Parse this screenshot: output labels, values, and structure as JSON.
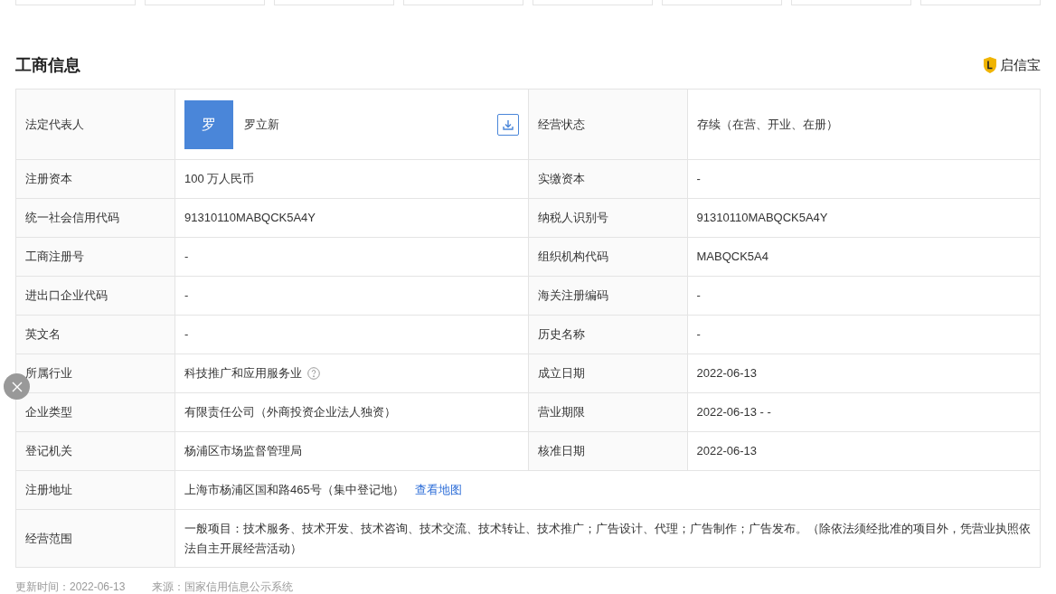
{
  "section": {
    "title": "工商信息",
    "brand": "启信宝"
  },
  "rows": [
    {
      "cells": [
        {
          "label": "法定代表人",
          "kind": "person",
          "avatar": "罗",
          "value": "罗立新"
        },
        {
          "label": "经营状态",
          "kind": "text",
          "value": "存续（在营、开业、在册）"
        }
      ]
    },
    {
      "cells": [
        {
          "label": "注册资本",
          "kind": "text",
          "value": "100 万人民币"
        },
        {
          "label": "实缴资本",
          "kind": "text",
          "value": "-"
        }
      ]
    },
    {
      "cells": [
        {
          "label": "统一社会信用代码",
          "kind": "text",
          "value": "91310110MABQCK5A4Y"
        },
        {
          "label": "纳税人识别号",
          "kind": "text",
          "value": "91310110MABQCK5A4Y"
        }
      ]
    },
    {
      "cells": [
        {
          "label": "工商注册号",
          "kind": "text",
          "value": "-"
        },
        {
          "label": "组织机构代码",
          "kind": "text",
          "value": "MABQCK5A4"
        }
      ]
    },
    {
      "cells": [
        {
          "label": "进出口企业代码",
          "kind": "text",
          "value": "-"
        },
        {
          "label": "海关注册编码",
          "kind": "text",
          "value": "-"
        }
      ]
    },
    {
      "cells": [
        {
          "label": "英文名",
          "kind": "text",
          "value": "-"
        },
        {
          "label": "历史名称",
          "kind": "text",
          "value": "-"
        }
      ]
    },
    {
      "cells": [
        {
          "label": "所属行业",
          "kind": "help",
          "value": "科技推广和应用服务业"
        },
        {
          "label": "成立日期",
          "kind": "text",
          "value": "2022-06-13"
        }
      ]
    },
    {
      "cells": [
        {
          "label": "企业类型",
          "kind": "text",
          "value": "有限责任公司（外商投资企业法人独资）"
        },
        {
          "label": "营业期限",
          "kind": "text",
          "value": "2022-06-13 - -"
        }
      ]
    },
    {
      "cells": [
        {
          "label": "登记机关",
          "kind": "text",
          "value": "杨浦区市场监督管理局"
        },
        {
          "label": "核准日期",
          "kind": "text",
          "value": "2022-06-13"
        }
      ]
    },
    {
      "cells": [
        {
          "label": "注册地址",
          "kind": "link",
          "value": "上海市杨浦区国和路465号（集中登记地）",
          "link": "查看地图"
        }
      ]
    },
    {
      "cells": [
        {
          "label": "经营范围",
          "kind": "text",
          "value": "一般项目：技术服务、技术开发、技术咨询、技术交流、技术转让、技术推广；广告设计、代理；广告制作；广告发布。（除依法须经批准的项目外，凭营业执照依法自主开展经营活动）"
        }
      ]
    }
  ],
  "footer": {
    "updated": "更新时间：2022-06-13",
    "source": "来源：国家信用信息公示系统"
  }
}
